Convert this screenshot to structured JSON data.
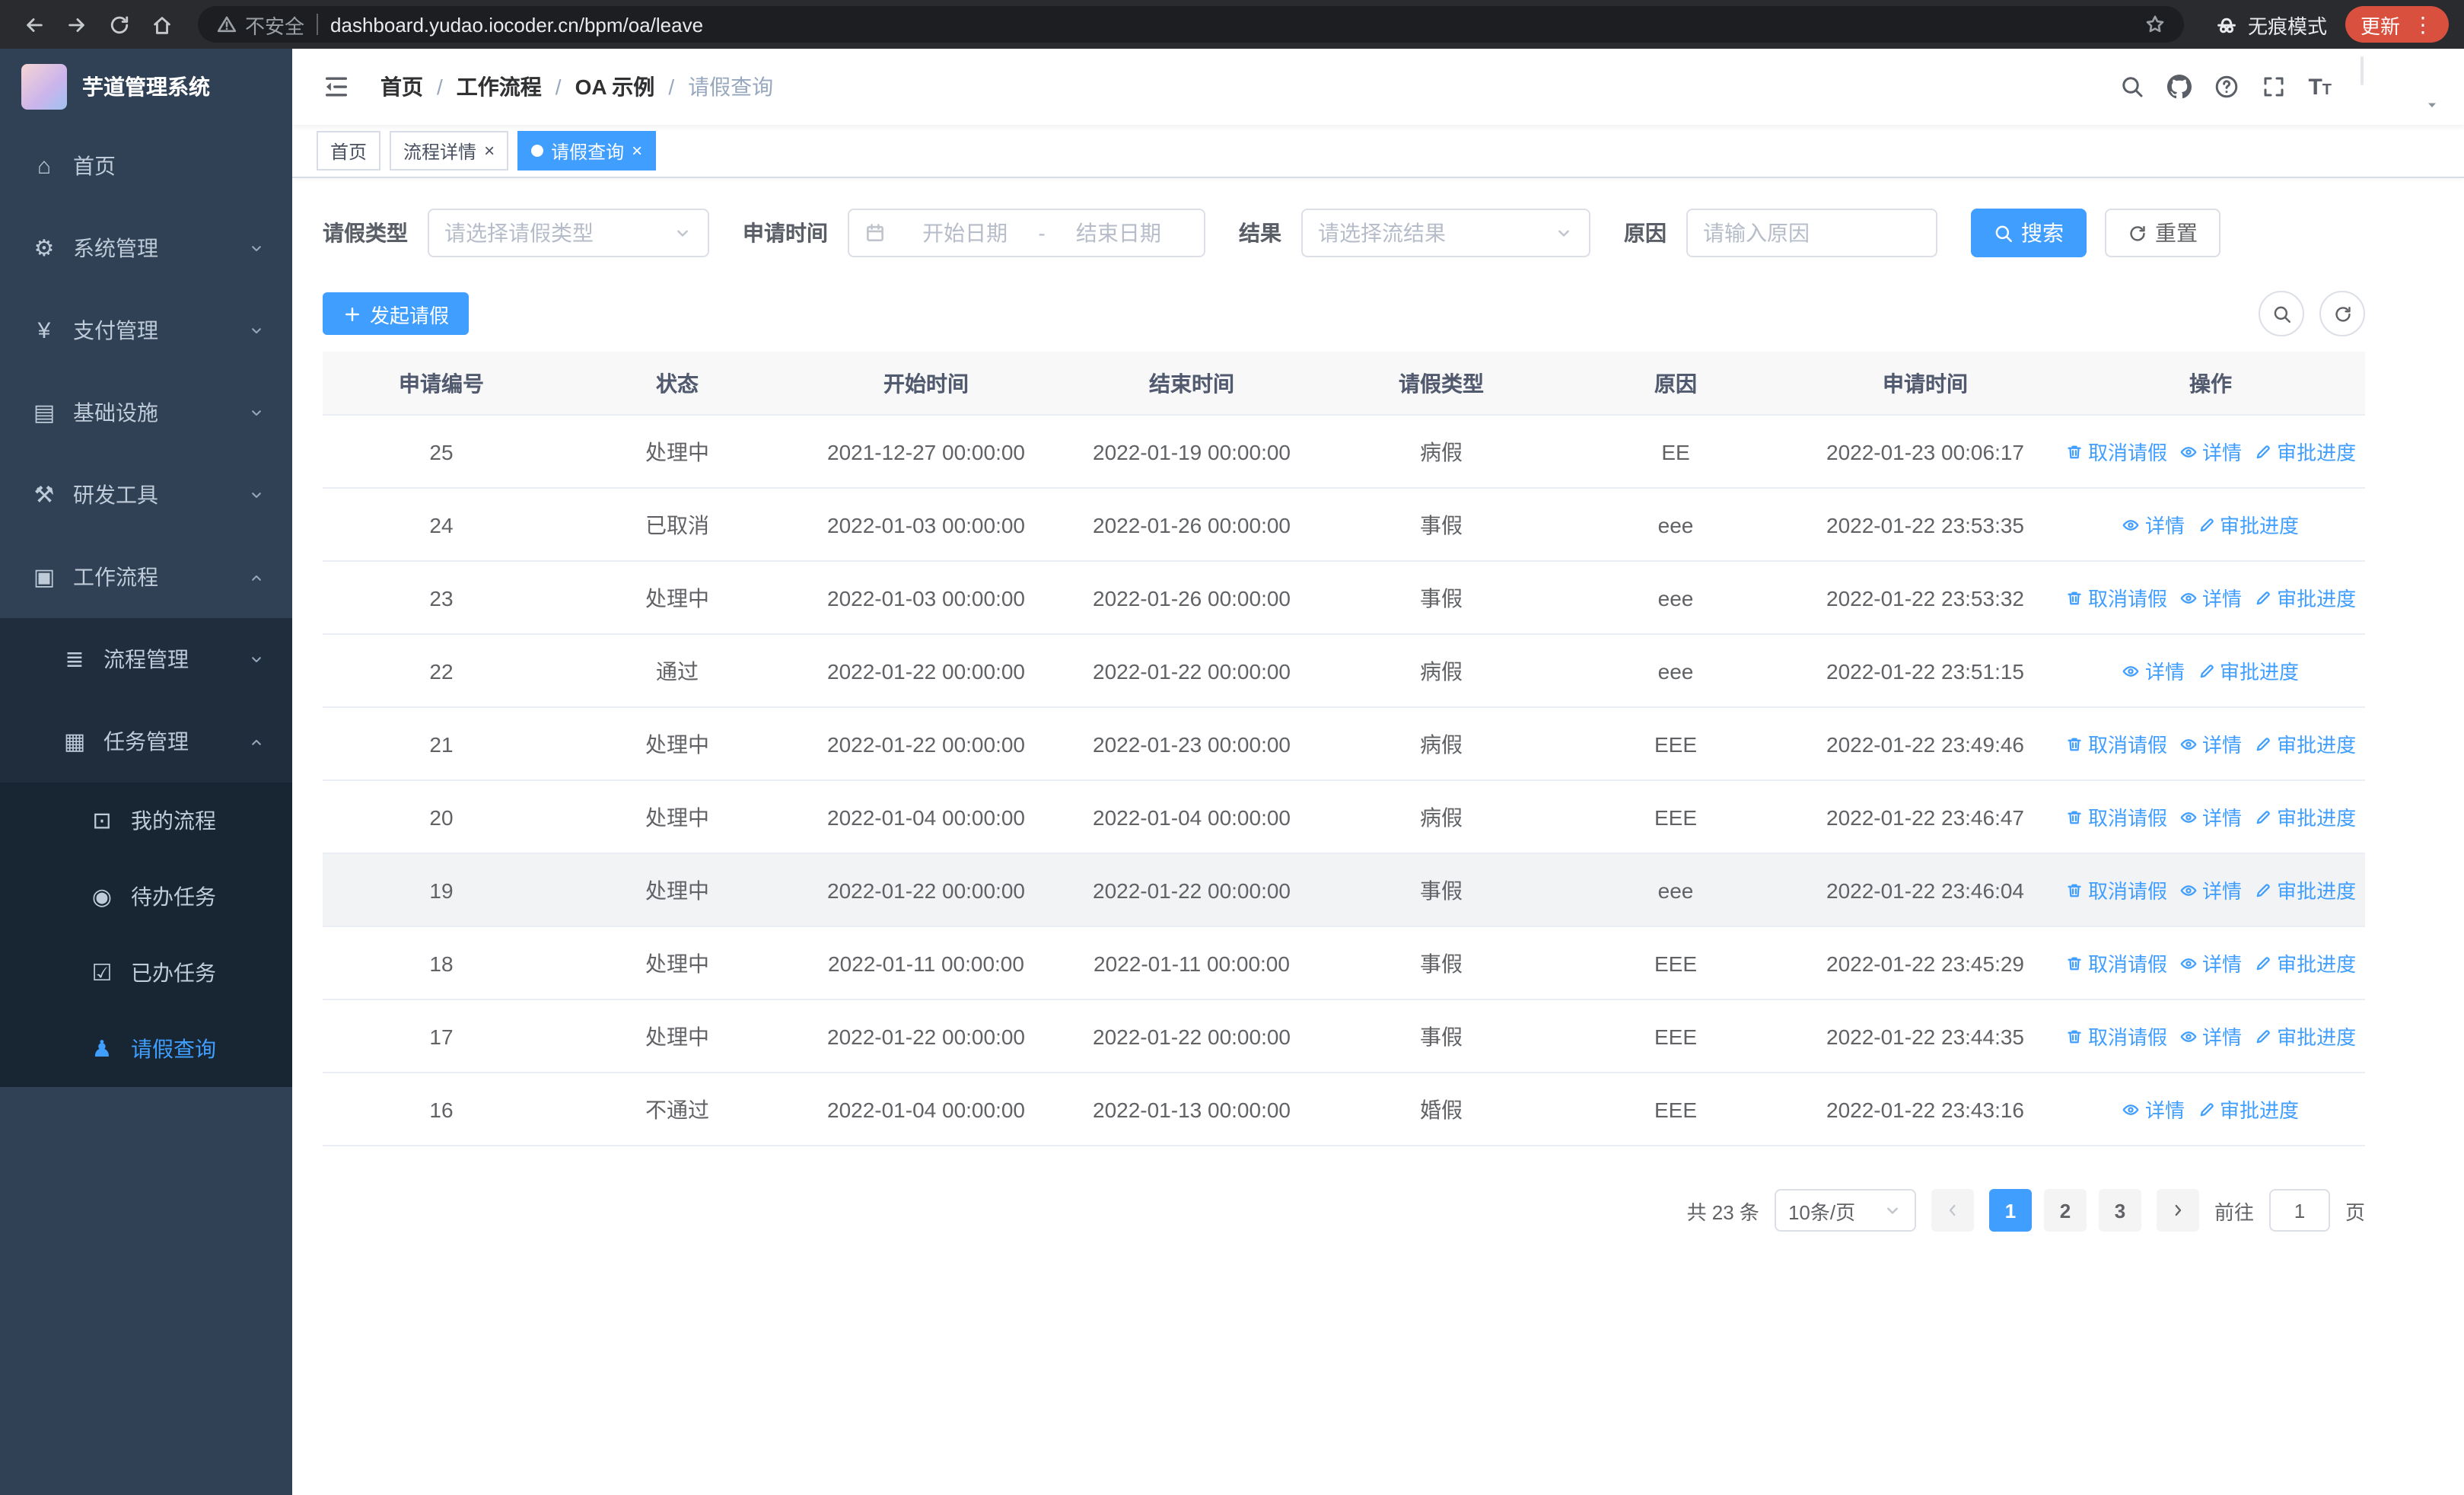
{
  "browser": {
    "security_label": "不安全",
    "url": "dashboard.yudao.iocoder.cn/bpm/oa/leave",
    "incognito_label": "无痕模式",
    "update_label": "更新"
  },
  "sidebar": {
    "title": "芋道管理系统",
    "menu": [
      {
        "key": "home",
        "label": "首页",
        "icon": "home-icon",
        "level": 1
      },
      {
        "key": "system",
        "label": "系统管理",
        "icon": "gear-icon",
        "level": 1,
        "chevron": "down"
      },
      {
        "key": "payment",
        "label": "支付管理",
        "icon": "yen-icon",
        "level": 1,
        "chevron": "down"
      },
      {
        "key": "infrastructure",
        "label": "基础设施",
        "icon": "infra-icon",
        "level": 1,
        "chevron": "down"
      },
      {
        "key": "devtools",
        "label": "研发工具",
        "icon": "tools-icon",
        "level": 1,
        "chevron": "down"
      },
      {
        "key": "workflow",
        "label": "工作流程",
        "icon": "workflow-icon",
        "level": 1,
        "chevron": "up"
      },
      {
        "key": "process-mgmt",
        "label": "流程管理",
        "icon": "process-icon",
        "level": 2,
        "chevron": "down"
      },
      {
        "key": "task-mgmt",
        "label": "任务管理",
        "icon": "tasks-icon",
        "level": 2,
        "chevron": "up"
      },
      {
        "key": "my-process",
        "label": "我的流程",
        "icon": "my-process-icon",
        "level": 3
      },
      {
        "key": "todo-tasks",
        "label": "待办任务",
        "icon": "todo-icon",
        "level": 3
      },
      {
        "key": "done-tasks",
        "label": "已办任务",
        "icon": "done-icon",
        "level": 3
      },
      {
        "key": "leave-query",
        "label": "请假查询",
        "icon": "leave-icon",
        "level": 3,
        "active": true
      }
    ]
  },
  "header": {
    "breadcrumb": [
      "首页",
      "工作流程",
      "OA 示例",
      "请假查询"
    ]
  },
  "tabs": [
    {
      "label": "首页",
      "closable": false,
      "active": false
    },
    {
      "label": "流程详情",
      "closable": true,
      "active": false
    },
    {
      "label": "请假查询",
      "closable": true,
      "active": true
    }
  ],
  "filters": {
    "leave_type_label": "请假类型",
    "leave_type_placeholder": "请选择请假类型",
    "apply_time_label": "申请时间",
    "start_date_placeholder": "开始日期",
    "date_separator": "-",
    "end_date_placeholder": "结束日期",
    "result_label": "结果",
    "result_placeholder": "请选择流结果",
    "reason_label": "原因",
    "reason_placeholder": "请输入原因",
    "search_label": "搜索",
    "reset_label": "重置"
  },
  "toolbar": {
    "create_label": "发起请假"
  },
  "table": {
    "columns": [
      "申请编号",
      "状态",
      "开始时间",
      "结束时间",
      "请假类型",
      "原因",
      "申请时间",
      "操作"
    ],
    "action_labels": {
      "cancel": "取消请假",
      "detail": "详情",
      "progress": "审批进度"
    },
    "action_icons": {
      "cancel": "trash-icon",
      "detail": "eye-icon",
      "progress": "edit-icon"
    },
    "rows": [
      {
        "id": "25",
        "status": "处理中",
        "start": "2021-12-27 00:00:00",
        "end": "2022-01-19 00:00:00",
        "type": "病假",
        "reason": "EE",
        "applied": "2022-01-23 00:06:17",
        "actions": [
          "cancel",
          "detail",
          "progress"
        ]
      },
      {
        "id": "24",
        "status": "已取消",
        "start": "2022-01-03 00:00:00",
        "end": "2022-01-26 00:00:00",
        "type": "事假",
        "reason": "eee",
        "applied": "2022-01-22 23:53:35",
        "actions": [
          "detail",
          "progress"
        ]
      },
      {
        "id": "23",
        "status": "处理中",
        "start": "2022-01-03 00:00:00",
        "end": "2022-01-26 00:00:00",
        "type": "事假",
        "reason": "eee",
        "applied": "2022-01-22 23:53:32",
        "actions": [
          "cancel",
          "detail",
          "progress"
        ]
      },
      {
        "id": "22",
        "status": "通过",
        "start": "2022-01-22 00:00:00",
        "end": "2022-01-22 00:00:00",
        "type": "病假",
        "reason": "eee",
        "applied": "2022-01-22 23:51:15",
        "actions": [
          "detail",
          "progress"
        ]
      },
      {
        "id": "21",
        "status": "处理中",
        "start": "2022-01-22 00:00:00",
        "end": "2022-01-23 00:00:00",
        "type": "病假",
        "reason": "EEE",
        "applied": "2022-01-22 23:49:46",
        "actions": [
          "cancel",
          "detail",
          "progress"
        ]
      },
      {
        "id": "20",
        "status": "处理中",
        "start": "2022-01-04 00:00:00",
        "end": "2022-01-04 00:00:00",
        "type": "病假",
        "reason": "EEE",
        "applied": "2022-01-22 23:46:47",
        "actions": [
          "cancel",
          "detail",
          "progress"
        ]
      },
      {
        "id": "19",
        "status": "处理中",
        "start": "2022-01-22 00:00:00",
        "end": "2022-01-22 00:00:00",
        "type": "事假",
        "reason": "eee",
        "applied": "2022-01-22 23:46:04",
        "actions": [
          "cancel",
          "detail",
          "progress"
        ],
        "highlighted": true
      },
      {
        "id": "18",
        "status": "处理中",
        "start": "2022-01-11 00:00:00",
        "end": "2022-01-11 00:00:00",
        "type": "事假",
        "reason": "EEE",
        "applied": "2022-01-22 23:45:29",
        "actions": [
          "cancel",
          "detail",
          "progress"
        ]
      },
      {
        "id": "17",
        "status": "处理中",
        "start": "2022-01-22 00:00:00",
        "end": "2022-01-22 00:00:00",
        "type": "事假",
        "reason": "EEE",
        "applied": "2022-01-22 23:44:35",
        "actions": [
          "cancel",
          "detail",
          "progress"
        ]
      },
      {
        "id": "16",
        "status": "不通过",
        "start": "2022-01-04 00:00:00",
        "end": "2022-01-13 00:00:00",
        "type": "婚假",
        "reason": "EEE",
        "applied": "2022-01-22 23:43:16",
        "actions": [
          "detail",
          "progress"
        ]
      }
    ]
  },
  "pagination": {
    "total_label": "共 23 条",
    "page_size_label": "10条/页",
    "pages": [
      "1",
      "2",
      "3"
    ],
    "active_page": "1",
    "goto_label": "前往",
    "goto_value": "1",
    "page_label": "页"
  },
  "colors": {
    "primary": "#409EFF",
    "sidebar_bg": "#304156",
    "submenu_bg": "#1f2d3d"
  }
}
